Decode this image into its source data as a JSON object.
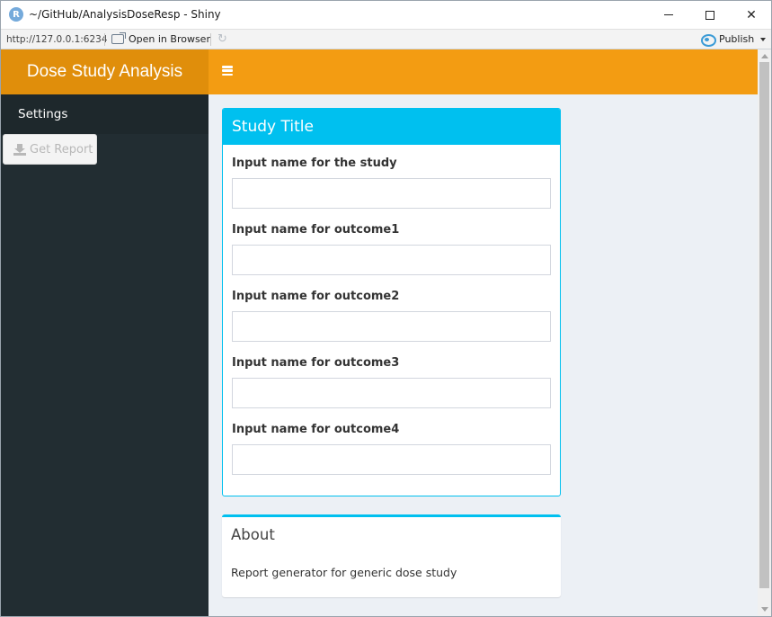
{
  "window": {
    "title": "~/GitHub/AnalysisDoseResp - Shiny",
    "app_icon_letter": "R"
  },
  "addressbar": {
    "url": "http://127.0.0.1:6234",
    "open_in_browser_label": "Open in Browser",
    "publish_label": "Publish"
  },
  "header": {
    "logo_text": "Dose Study Analysis",
    "accent_color": "#f39c12",
    "logo_color": "#e08e0b"
  },
  "sidebar": {
    "menu_item": "Settings",
    "report_button_label": "Get Report"
  },
  "study_box": {
    "title": "Study Title",
    "fields": [
      {
        "label": "Input name for the study",
        "value": ""
      },
      {
        "label": "Input name for outcome1",
        "value": ""
      },
      {
        "label": "Input name for outcome2",
        "value": ""
      },
      {
        "label": "Input name for outcome3",
        "value": ""
      },
      {
        "label": "Input name for outcome4",
        "value": ""
      }
    ]
  },
  "about_box": {
    "title": "About",
    "text": "Report generator for generic dose study"
  },
  "icons": {
    "app": "r-logo-icon",
    "menu": "hamburger-icon",
    "download": "download-icon",
    "publish": "publish-icon"
  }
}
